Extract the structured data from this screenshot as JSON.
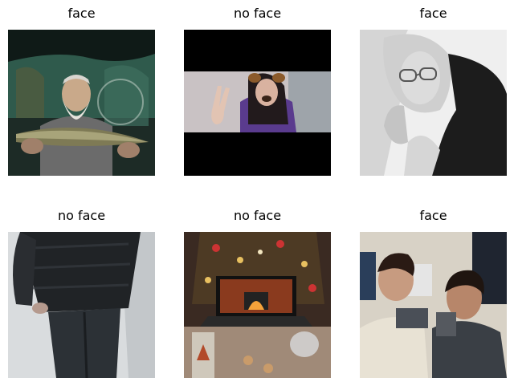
{
  "grid": {
    "panels": [
      {
        "label": "face",
        "subject": "older bearded man holding a fish under a green tent"
      },
      {
        "label": "no face",
        "subject": "girl with dog-ear filter making peace sign, letterboxed"
      },
      {
        "label": "face",
        "subject": "black-and-white portrait of woman with glasses"
      },
      {
        "label": "no face",
        "subject": "person in black puffer jacket seen from behind"
      },
      {
        "label": "no face",
        "subject": "laptop with fireplace screen in front of christmas tree"
      },
      {
        "label": "face",
        "subject": "two young men taking a selfie"
      }
    ]
  }
}
